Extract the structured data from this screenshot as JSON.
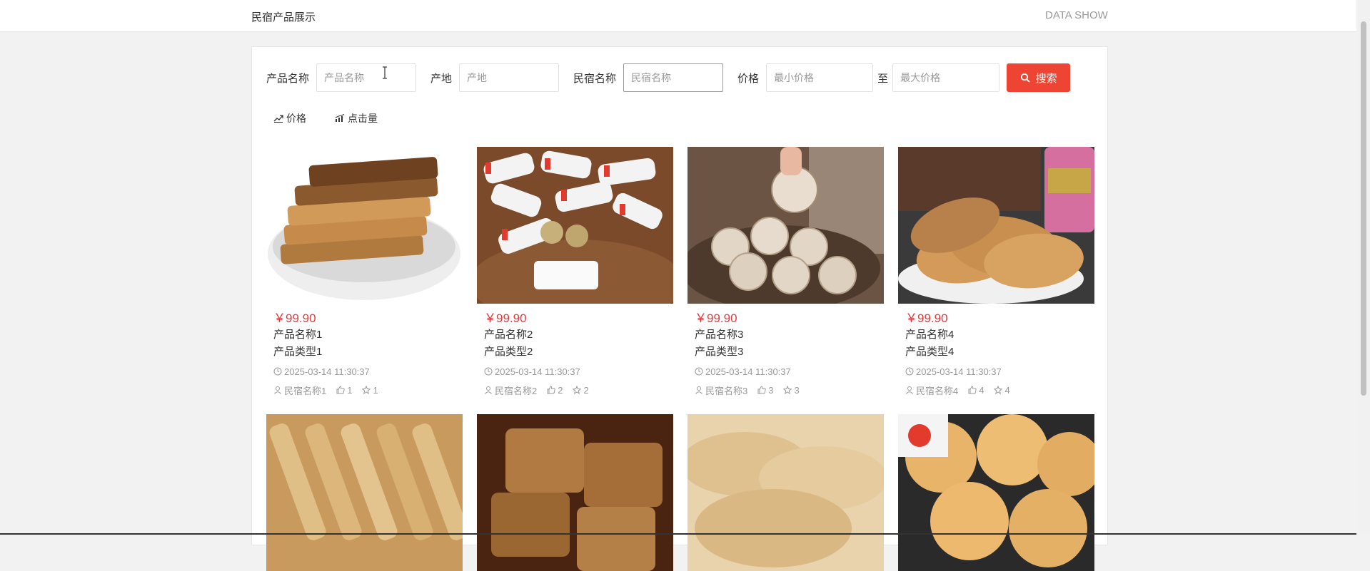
{
  "header": {
    "title": "民宿产品展示",
    "right_text": "DATA SHOW"
  },
  "search": {
    "name_label": "产品名称",
    "name_placeholder": "产品名称",
    "origin_label": "产地",
    "origin_placeholder": "产地",
    "homestay_label": "民宿名称",
    "homestay_placeholder": "民宿名称",
    "price_label": "价格",
    "min_placeholder": "最小价格",
    "to_label": "至",
    "max_placeholder": "最大价格",
    "button_label": "搜索"
  },
  "sort": {
    "price_label": "价格",
    "clicks_label": "点击量"
  },
  "products": [
    {
      "price": "￥99.90",
      "name": "产品名称1",
      "type": "产品类型1",
      "time": "2025-03-14 11:30:37",
      "homestay": "民宿名称1",
      "likes": "1",
      "favs": "1"
    },
    {
      "price": "￥99.90",
      "name": "产品名称2",
      "type": "产品类型2",
      "time": "2025-03-14 11:30:37",
      "homestay": "民宿名称2",
      "likes": "2",
      "favs": "2"
    },
    {
      "price": "￥99.90",
      "name": "产品名称3",
      "type": "产品类型3",
      "time": "2025-03-14 11:30:37",
      "homestay": "民宿名称3",
      "likes": "3",
      "favs": "3"
    },
    {
      "price": "￥99.90",
      "name": "产品名称4",
      "type": "产品类型4",
      "time": "2025-03-14 11:30:37",
      "homestay": "民宿名称4",
      "likes": "4",
      "favs": "4"
    }
  ],
  "colors": {
    "accent": "#ee4433",
    "price": "#e4393c",
    "muted": "#999999"
  }
}
